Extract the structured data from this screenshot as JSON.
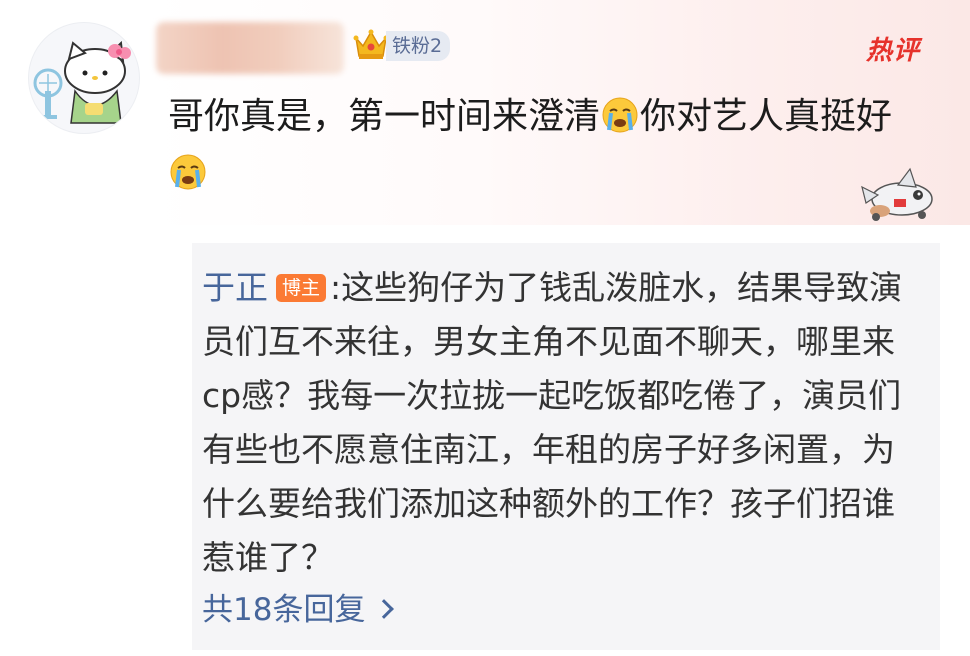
{
  "comment": {
    "fan_badge": "铁粉2",
    "hot_tag": "热评",
    "text_part1": "哥你真是，第一时间来澄清",
    "text_part2": "你对艺人真挺好"
  },
  "reply": {
    "author": "于正",
    "author_badge": "博主",
    "text": ":这些狗仔为了钱乱泼脏水，结果导致演员们互不来往，男女主角不见面不聊天，哪里来cp感？我每一次拉拢一起吃饭都吃倦了，演员们有些也不愿意住南江，年租的房子好多闲置，为什么要给我们添加这种额外的工作？孩子们招谁惹谁了？",
    "count_label": "共18条回复"
  },
  "icons": {
    "avatar": "hello-kitty-avatar",
    "crown": "crown-icon",
    "emoji": "crying-face-emoji",
    "decoration": "cartoon-plane-icon",
    "chevron": "chevron-right-icon"
  },
  "colors": {
    "link_blue": "#47669b",
    "hot_red": "#e6322b",
    "author_badge": "#fb7a34",
    "reply_bg": "#f5f5f7"
  }
}
